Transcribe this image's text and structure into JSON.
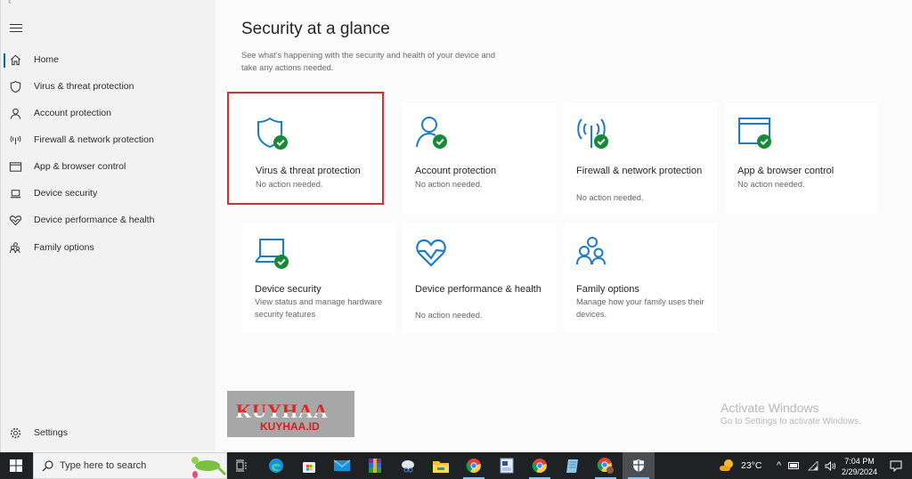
{
  "sidebar": {
    "back_label": "‹",
    "menu_icon": "hamburger-icon",
    "items": [
      {
        "label": "Home",
        "icon": "home-icon",
        "active": true
      },
      {
        "label": "Virus & threat protection",
        "icon": "shield-icon"
      },
      {
        "label": "Account protection",
        "icon": "person-icon"
      },
      {
        "label": "Firewall & network protection",
        "icon": "wifi-antenna-icon"
      },
      {
        "label": "App & browser control",
        "icon": "browser-window-icon"
      },
      {
        "label": "Device security",
        "icon": "laptop-icon"
      },
      {
        "label": "Device performance & health",
        "icon": "heart-pulse-icon"
      },
      {
        "label": "Family options",
        "icon": "family-icon"
      }
    ],
    "settings_label": "Settings"
  },
  "main": {
    "title": "Security at a glance",
    "subtitle": "See what's happening with the security and health of your device and take any actions needed.",
    "cards": [
      {
        "title": "Virus & threat protection",
        "desc": "No action needed.",
        "status": "ok",
        "selected": true
      },
      {
        "title": "Account protection",
        "desc": "No action needed.",
        "status": "ok"
      },
      {
        "title": "Firewall & network protection",
        "desc": "No action needed.",
        "status": "ok"
      },
      {
        "title": "App & browser control",
        "desc": "No action needed.",
        "status": "ok"
      },
      {
        "title": "Device security",
        "desc": "View status and manage hardware security features",
        "status": "ok"
      },
      {
        "title": "Device performance & health",
        "desc": "No action needed.",
        "status": "none"
      },
      {
        "title": "Family options",
        "desc": "Manage how your family uses their devices.",
        "status": "none"
      }
    ]
  },
  "watermark": {
    "big": "KUYHAA",
    "small": "KUYHAA.ID"
  },
  "activation": {
    "title": "Activate Windows",
    "message": "Go to Settings to activate Windows."
  },
  "taskbar": {
    "search_placeholder": "Type here to search",
    "apps": [
      "task-view",
      "edge",
      "microsoft-store",
      "mail",
      "winrar",
      "snipping-tool",
      "file-explorer",
      "chrome",
      "word-document",
      "notepad",
      "chrome-profile",
      "windows-security"
    ],
    "weather": "23°C",
    "time": "7:04 PM",
    "date": "2/29/2024"
  },
  "colors": {
    "accent": "#0067b8",
    "icon_blue": "#1e7bc6",
    "check_green": "#168a38",
    "selection_red": "#d32f2f"
  }
}
